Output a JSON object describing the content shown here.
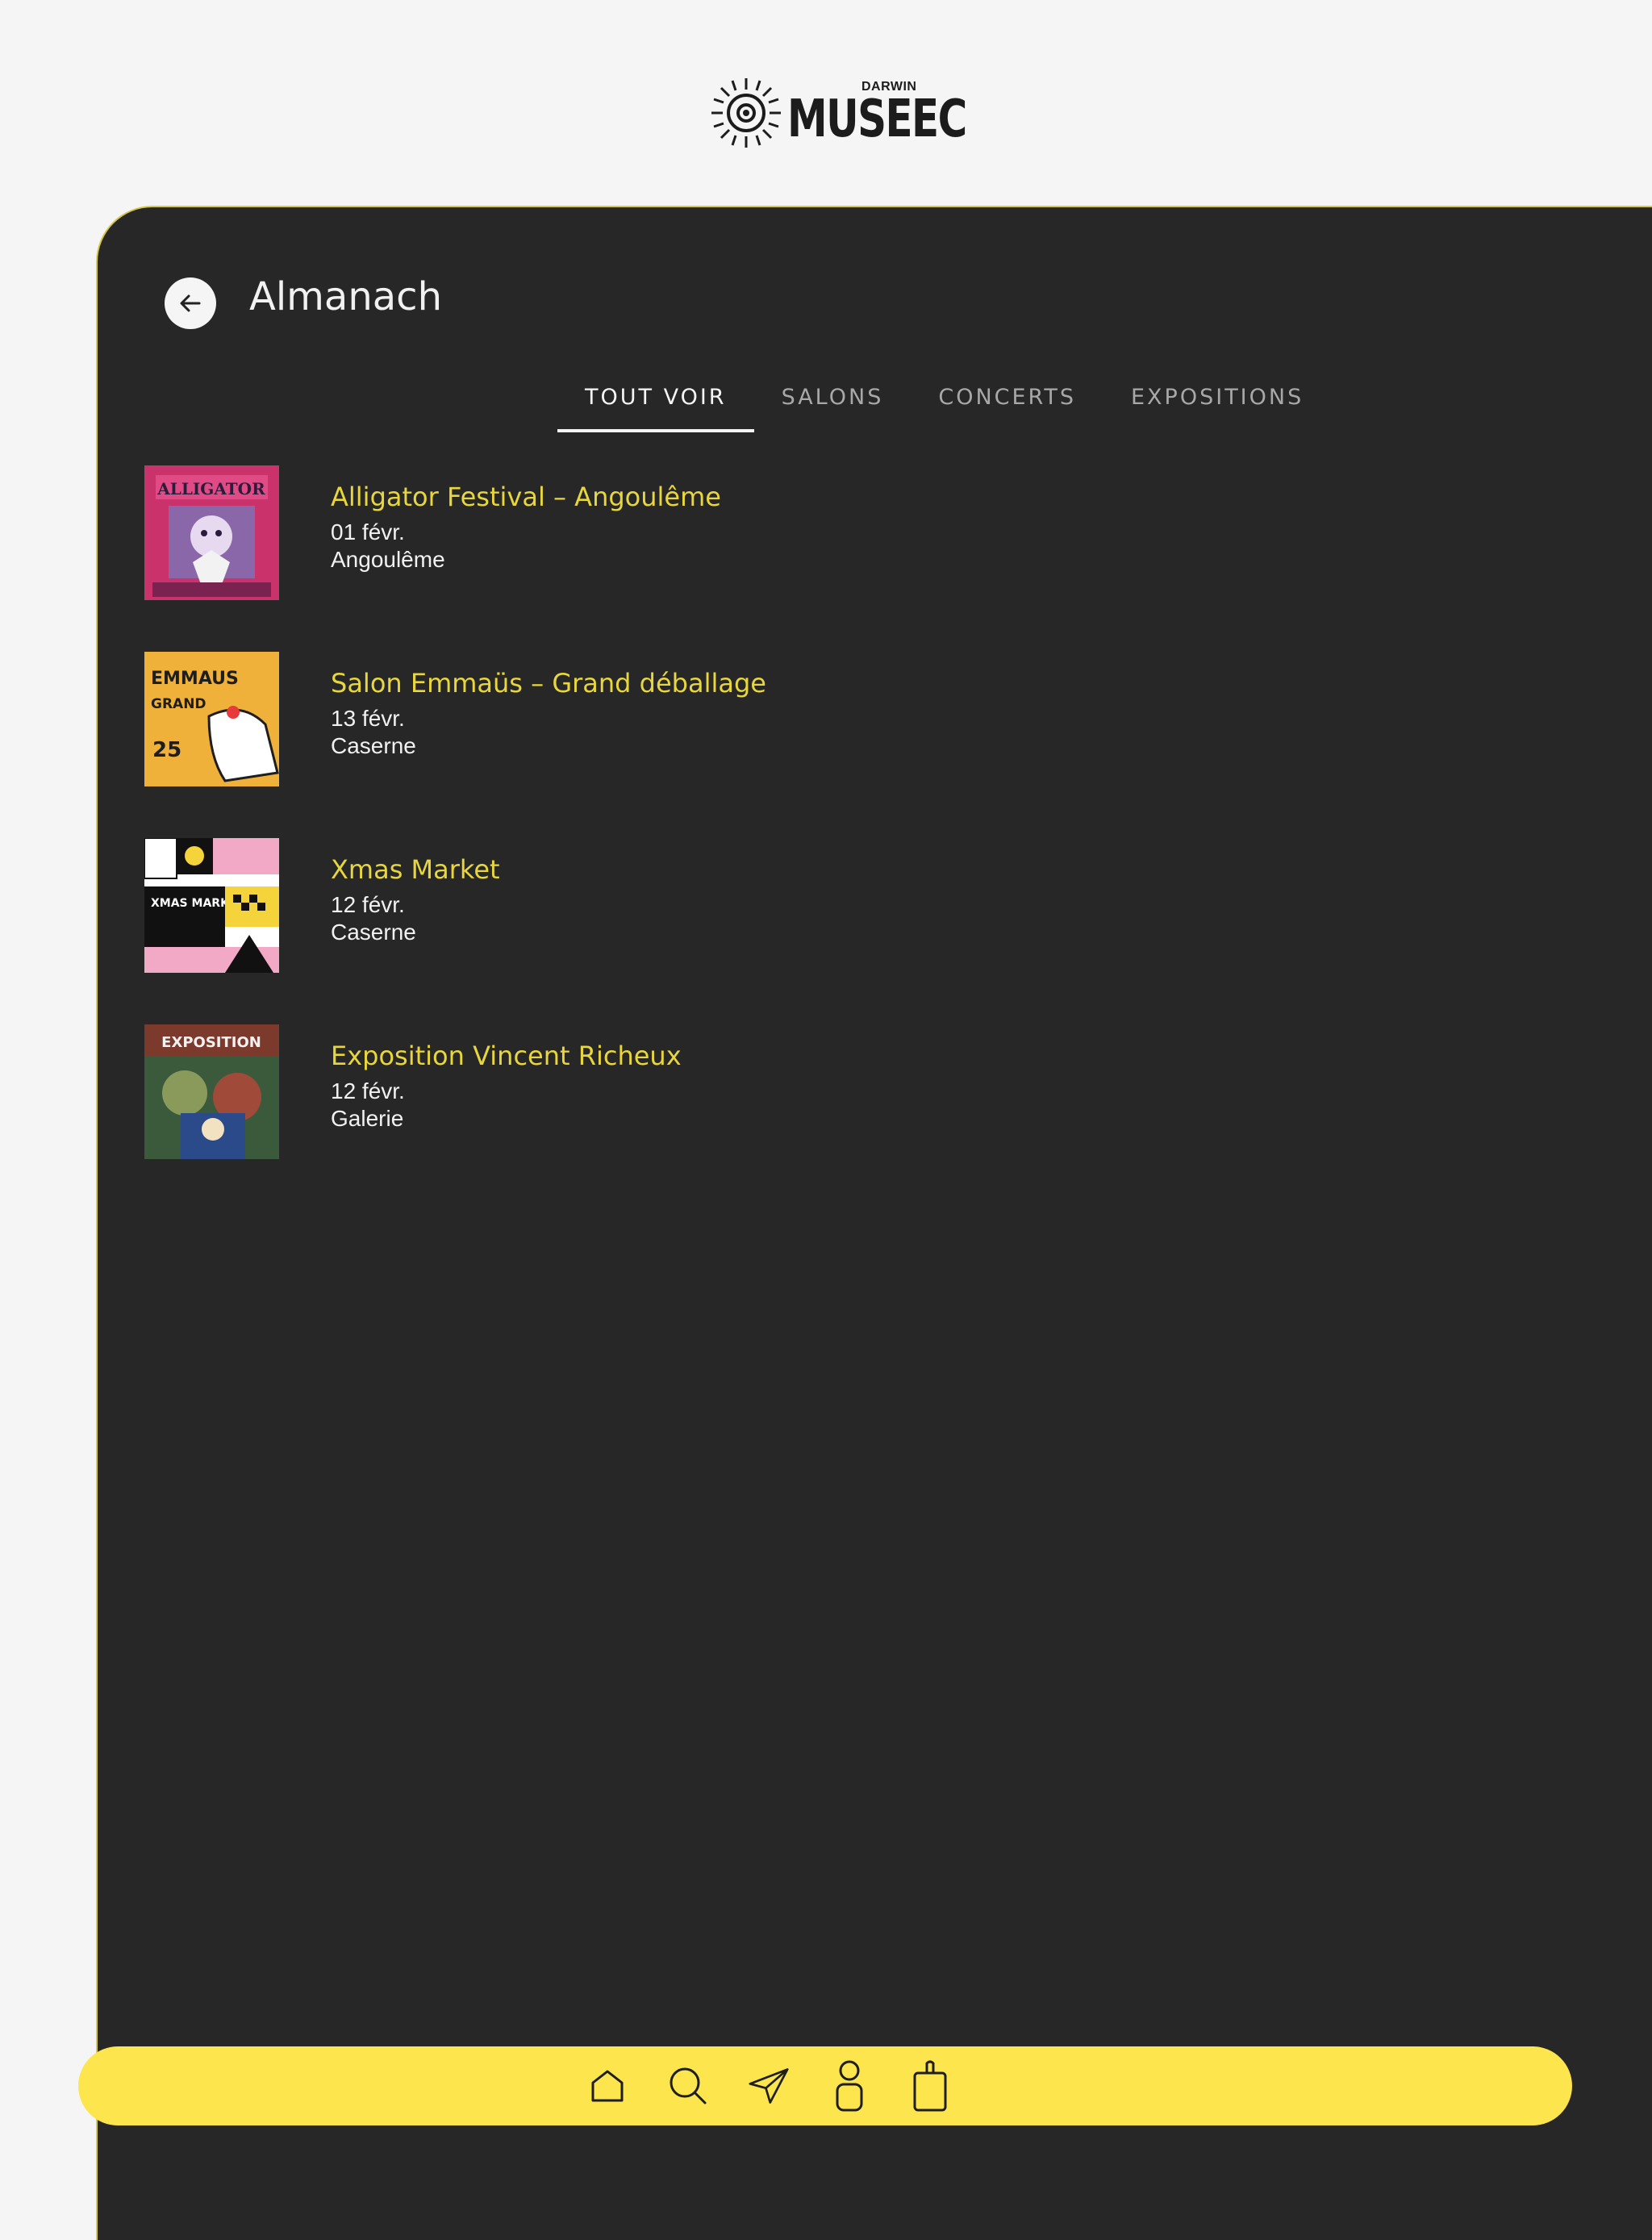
{
  "brand": {
    "small": "DARWIN",
    "big": "MUSEEC"
  },
  "page": {
    "title": "Almanach"
  },
  "tabs": [
    {
      "label": "TOUT VOIR",
      "active": true
    },
    {
      "label": "SALONS",
      "active": false
    },
    {
      "label": "CONCERTS",
      "active": false
    },
    {
      "label": "EXPOSITIONS",
      "active": false
    }
  ],
  "events": [
    {
      "title": "Alligator Festival – Angoulême",
      "date": "01 févr.",
      "place": "Angoulême",
      "poster_text": "ALLIGATOR"
    },
    {
      "title": "Salon Emmaüs – Grand déballage",
      "date": "13 févr.",
      "place": "Caserne",
      "poster_text": "EMMAUS"
    },
    {
      "title": "Xmas Market",
      "date": "12 févr.",
      "place": "Caserne",
      "poster_text": "XMAS MARKET"
    },
    {
      "title": "Exposition Vincent Richeux",
      "date": "12 févr.",
      "place": "Galerie",
      "poster_text": "EXPOSITION"
    }
  ],
  "nav": {
    "icons": [
      "home-icon",
      "search-icon",
      "send-icon",
      "profile-icon",
      "bag-icon"
    ]
  },
  "colors": {
    "panel": "#282728",
    "accent": "#fde64d",
    "title_yellow": "#e7d63c",
    "background": "#f5f5f5"
  }
}
